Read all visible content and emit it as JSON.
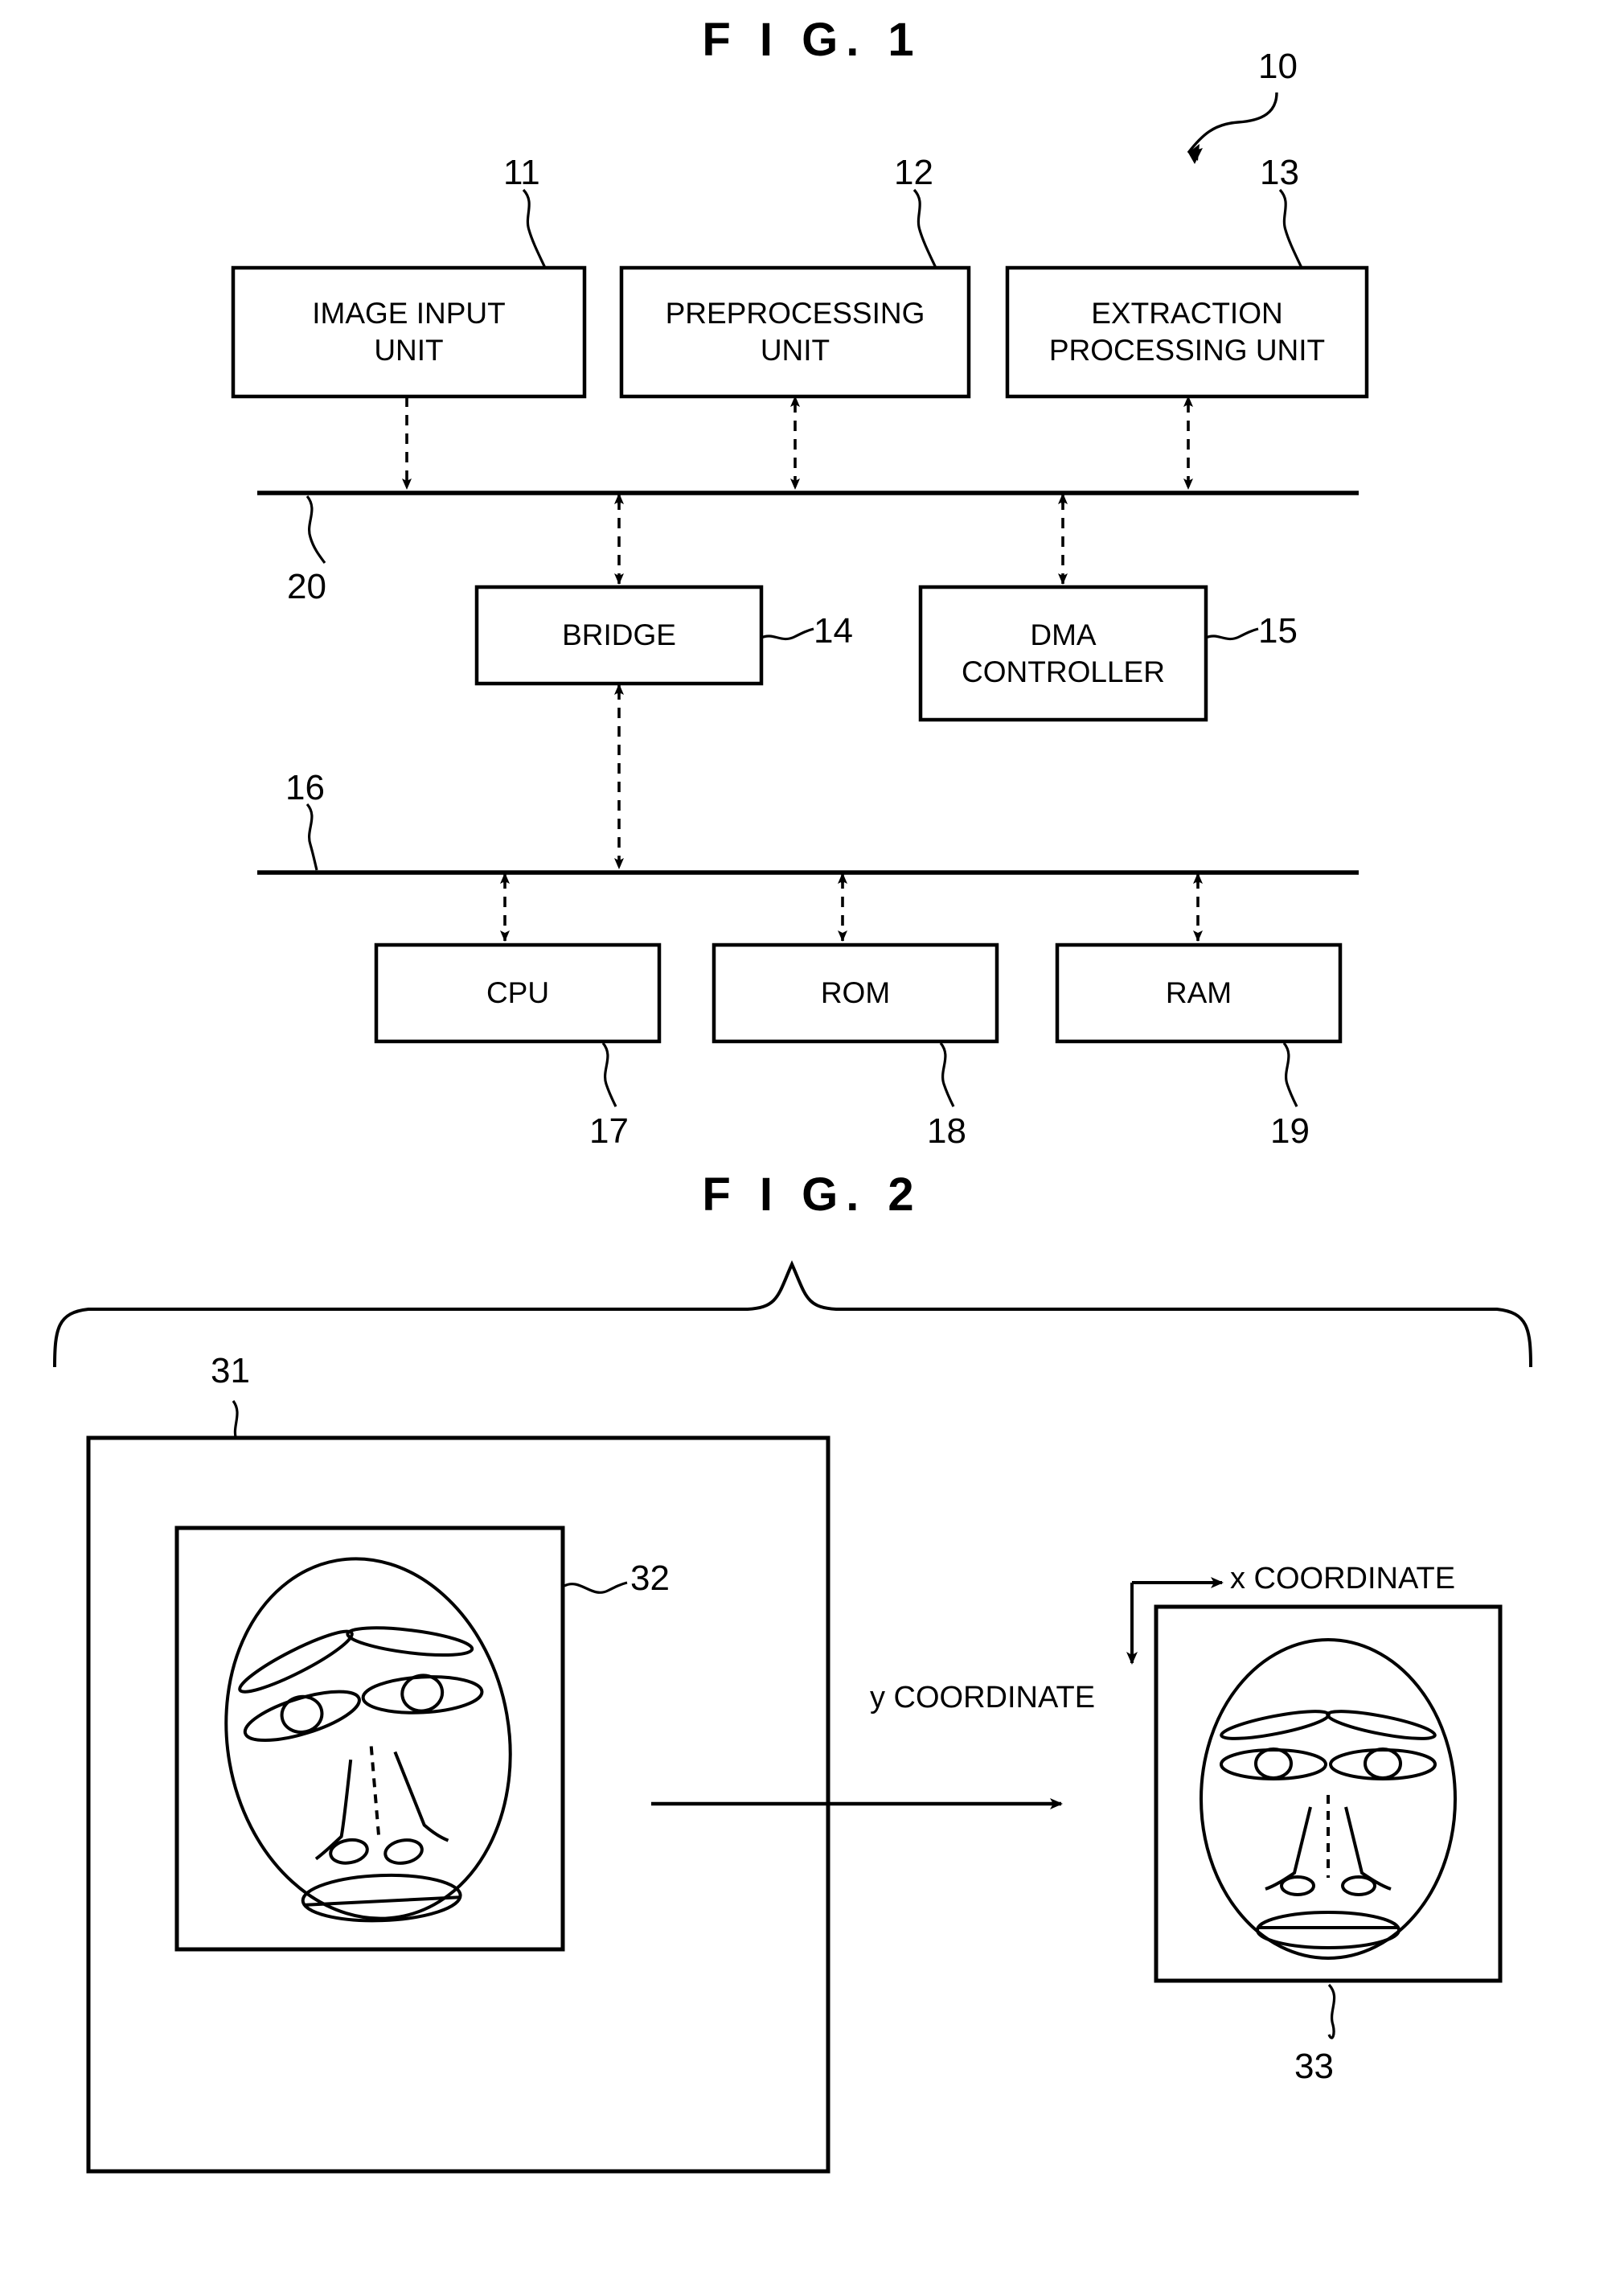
{
  "figures": [
    {
      "title": "F I G. 1",
      "system_ref": "10",
      "blocks": [
        {
          "id": "image-input-unit",
          "label": "IMAGE INPUT\nUNIT",
          "ref": "11"
        },
        {
          "id": "preprocessing-unit",
          "label": "PREPROCESSING\nUNIT",
          "ref": "12"
        },
        {
          "id": "extraction-processing-unit",
          "label": "EXTRACTION\nPROCESSING UNIT",
          "ref": "13"
        },
        {
          "id": "bridge",
          "label": "BRIDGE",
          "ref": "14"
        },
        {
          "id": "dma-controller",
          "label": "DMA\nCONTROLLER",
          "ref": "15"
        },
        {
          "id": "cpu",
          "label": "CPU",
          "ref": "17"
        },
        {
          "id": "rom",
          "label": "ROM",
          "ref": "18"
        },
        {
          "id": "ram",
          "label": "RAM",
          "ref": "19"
        }
      ],
      "buses": [
        {
          "id": "upper-bus",
          "ref": "20"
        },
        {
          "id": "lower-bus",
          "ref": "16"
        }
      ]
    },
    {
      "title": "F I G. 2",
      "refs": {
        "input_image": "31",
        "face_region": "32",
        "normalized_face": "33"
      },
      "axis_labels": {
        "x": "x COORDINATE",
        "y": "y COORDINATE"
      }
    }
  ],
  "fig1": {
    "title": "F I G. 1",
    "ref_10": "10",
    "ref_11": "11",
    "ref_12": "12",
    "ref_13": "13",
    "ref_14": "14",
    "ref_15": "15",
    "ref_16": "16",
    "ref_17": "17",
    "ref_18": "18",
    "ref_19": "19",
    "ref_20": "20",
    "image_input_unit_l1": "IMAGE INPUT",
    "image_input_unit_l2": "UNIT",
    "preprocessing_unit_l1": "PREPROCESSING",
    "preprocessing_unit_l2": "UNIT",
    "extraction_unit_l1": "EXTRACTION",
    "extraction_unit_l2": "PROCESSING UNIT",
    "bridge": "BRIDGE",
    "dma_l1": "DMA",
    "dma_l2": "CONTROLLER",
    "cpu": "CPU",
    "rom": "ROM",
    "ram": "RAM"
  },
  "fig2": {
    "title": "F I G. 2",
    "ref_31": "31",
    "ref_32": "32",
    "ref_33": "33",
    "x_coordinate": "x COORDINATE",
    "y_coordinate": "y COORDINATE"
  },
  "colors": {
    "ink": "#000000",
    "paper": "#ffffff"
  }
}
